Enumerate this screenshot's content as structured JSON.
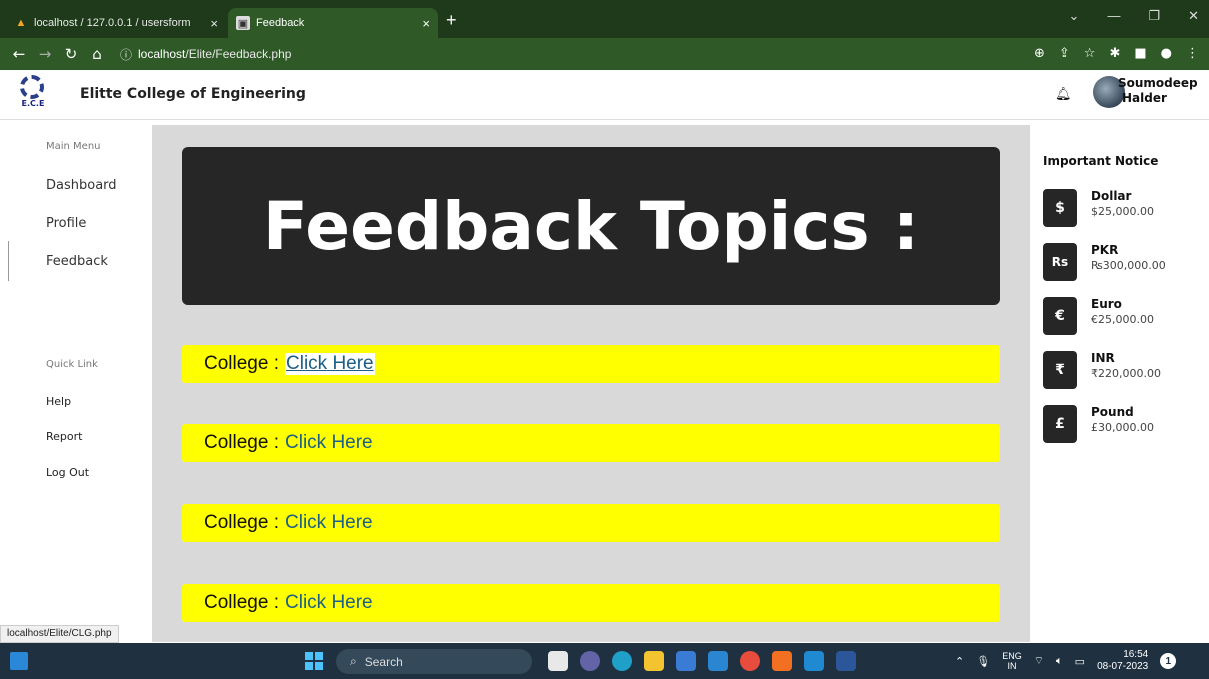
{
  "browser": {
    "tabs": [
      {
        "title": "localhost / 127.0.0.1 / usersform",
        "close": "×"
      },
      {
        "title": "Feedback",
        "close": "×"
      }
    ],
    "new_tab": "+",
    "url_host": "localhost",
    "url_path": "/Elite/Feedback.php",
    "status_url": "localhost/Elite/CLG.php"
  },
  "header": {
    "logo_text": "E.C.E",
    "college_name": "Elitte College of Engineering",
    "user_first": "Soumodeep",
    "user_last": "Halder"
  },
  "sidebar": {
    "main_heading": "Main Menu",
    "main_items": [
      "Dashboard",
      "Profile",
      "Feedback"
    ],
    "quick_heading": "Quick Link",
    "quick_items": [
      "Help",
      "Report",
      "Log Out"
    ]
  },
  "main": {
    "banner_title": "Feedback Topics :",
    "rows": [
      {
        "label": "College :",
        "link": "Click Here"
      },
      {
        "label": "College :",
        "link": "Click Here"
      },
      {
        "label": "College :",
        "link": "Click Here"
      },
      {
        "label": "College :",
        "link": "Click Here"
      }
    ]
  },
  "notices": {
    "title": "Important Notice",
    "items": [
      {
        "symbol": "$",
        "name": "Dollar",
        "value": "$25,000.00"
      },
      {
        "symbol": "Rs",
        "name": "PKR",
        "value": "₨300,000.00"
      },
      {
        "symbol": "€",
        "name": "Euro",
        "value": "€25,000.00"
      },
      {
        "symbol": "₹",
        "name": "INR",
        "value": "₹220,000.00"
      },
      {
        "symbol": "£",
        "name": "Pound",
        "value": "£30,000.00"
      }
    ]
  },
  "taskbar": {
    "search": "Search",
    "lang1": "ENG",
    "lang2": "IN",
    "time": "16:54",
    "date": "08-07-2023",
    "badge": "1"
  },
  "colors": {
    "banner_bg": "#262626",
    "row_bg": "#ffff00",
    "content_bg": "#d9d9d9",
    "link": "#1b5e87"
  }
}
